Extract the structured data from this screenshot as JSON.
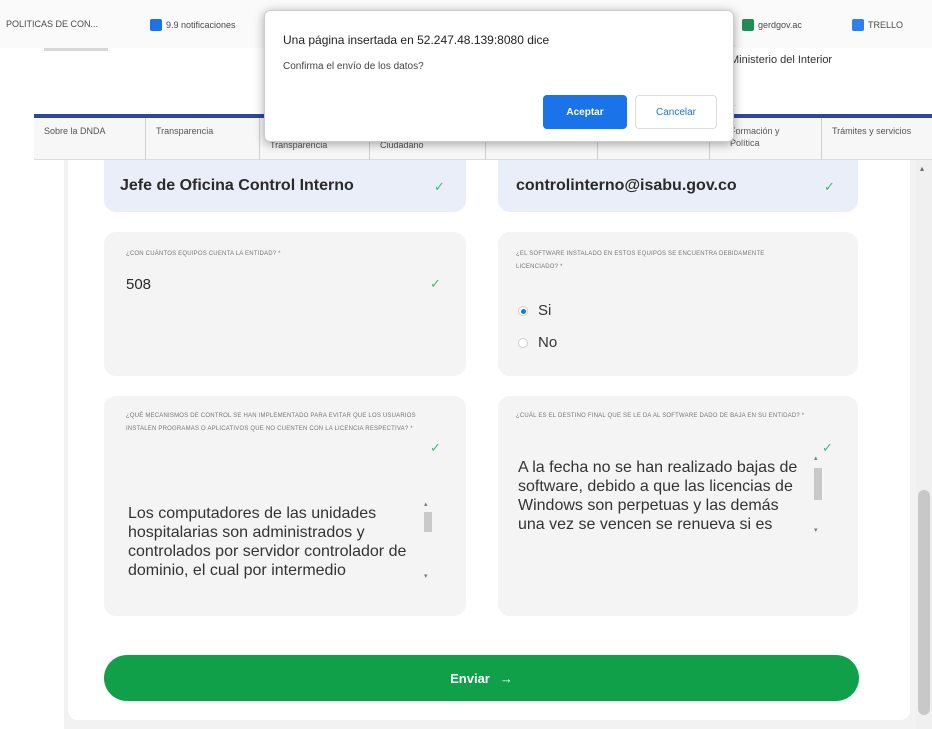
{
  "bookmarks": [
    {
      "label": "POLITICAS DE CON...",
      "color": ""
    },
    {
      "label": "9.9 notificaciones",
      "color": "#1a73e8"
    },
    {
      "label": "gerdgov.ac",
      "color": "#1f8f55"
    },
    {
      "label": "TRELLO",
      "color": "#2f80ed"
    }
  ],
  "header": {
    "ministerio": "Ministerio del Interior",
    "ministerio_small": "...",
    "last_update": "..."
  },
  "nav": {
    "items": [
      "Sobre la DNDA",
      "Transparencia",
      "Transparencia",
      "Ciudadano",
      "",
      "",
      "Formación y Política",
      "Trámites y servicios"
    ]
  },
  "dialog": {
    "title": "Una página insertada en 52.247.48.139:8080 dice",
    "message": "Confirma el envío de los datos?",
    "accept_label": "Aceptar",
    "cancel_label": "Cancelar"
  },
  "form": {
    "cargo_value": "Jefe de Oficina Control Interno",
    "email_value": "controlinterno@isabu.gov.co",
    "equipos": {
      "label": "¿Con cuántos equipos cuenta la entidad? *",
      "value": "508"
    },
    "licenciado": {
      "label": "¿El software instalado en estos equipos se encuentra debidamente licenciado? *",
      "options": [
        "Si",
        "No"
      ],
      "selected": "Si"
    },
    "mecanismos": {
      "label": "¿Qué mecanismos de control se han implementado para evitar que los usuarios instalen programas o aplicativos que no cuenten con la licencia respectiva? *",
      "value": "Los computadores de las unidades hospitalarias son administrados y controlados por servidor controlador de dominio, el cual por intermedio"
    },
    "destino": {
      "label": "¿Cuál es el destino final que se le da al software dado de baja en su entidad? *",
      "value": "A la fecha no se han realizado bajas de software, debido a que las licencias de Windows son perpetuas y las demás una vez se vencen se renueva si es"
    },
    "submit_label": "Enviar",
    "submit_arrow": "→"
  },
  "icons": {
    "check": "check-icon",
    "arrow": "arrow-right-icon"
  },
  "colors": {
    "accent": "#1a73e8",
    "submit": "#10a04a",
    "nav_bar": "#2b4a9b",
    "check": "#41b97a"
  }
}
